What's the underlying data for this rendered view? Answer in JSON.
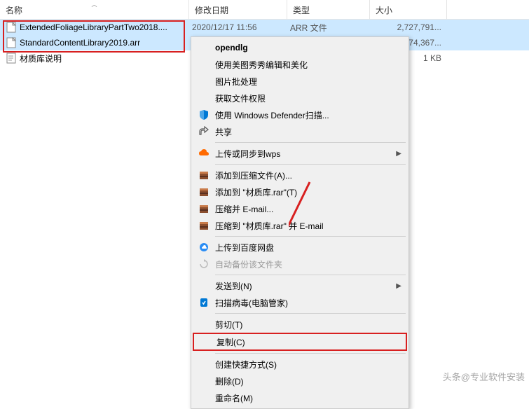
{
  "columns": {
    "name": "名称",
    "date": "修改日期",
    "type": "类型",
    "size": "大小"
  },
  "files": [
    {
      "name": "ExtendedFoliageLibraryPartTwo2018....",
      "date": "2020/12/17 11:56",
      "type": "ARR 文件",
      "size": "2,727,791..."
    },
    {
      "name": "StandardContentLibrary2019.arr",
      "date": "",
      "type": "",
      "size": "074,367..."
    },
    {
      "name": "材质库说明",
      "date": "",
      "type": "",
      "size": "1 KB"
    }
  ],
  "menu": {
    "opendlg": "opendlg",
    "meitu": "使用美图秀秀编辑和美化",
    "batch": "图片批处理",
    "perm": "获取文件权限",
    "defender": "使用 Windows Defender扫描...",
    "share": "共享",
    "wps": "上传或同步到wps",
    "addArchive": "添加到压缩文件(A)...",
    "addRar": "添加到 \"材质库.rar\"(T)",
    "compressEmail": "压缩并 E-mail...",
    "compressRarEmail": "压缩到 \"材质库.rar\" 并 E-mail",
    "baidu": "上传到百度网盘",
    "autoBackup": "自动备份该文件夹",
    "sendTo": "发送到(N)",
    "scanVirus": "扫描病毒(电脑管家)",
    "cut": "剪切(T)",
    "copy": "复制(C)",
    "shortcut": "创建快捷方式(S)",
    "delete": "删除(D)",
    "rename": "重命名(M)"
  },
  "watermark": "头条@专业软件安装",
  "watermark2": ""
}
